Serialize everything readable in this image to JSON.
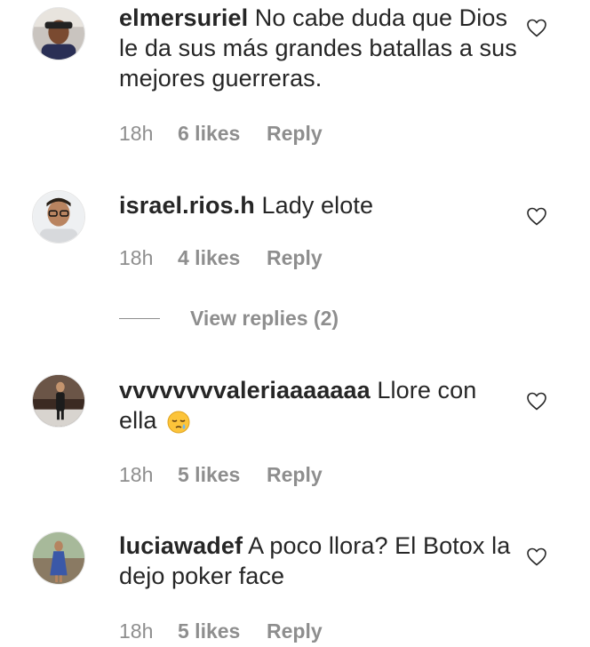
{
  "comments": [
    {
      "username": "elmersuriel",
      "text": " No cabe duda que Dios le da sus más grandes batallas a sus mejores guerreras.",
      "time": "18h",
      "likes": "6 likes",
      "reply": "Reply",
      "avatar_icon": "avatar-photo-man-cap"
    },
    {
      "username": "israel.rios.h",
      "text": " Lady elote",
      "time": "18h",
      "likes": "4 likes",
      "reply": "Reply",
      "avatar_icon": "avatar-photo-man-glasses"
    },
    {
      "username": "vvvvvvvvaleriaaaaaaa",
      "text": " Llore con ella",
      "emoji": "😪",
      "time": "18h",
      "likes": "5 likes",
      "reply": "Reply",
      "avatar_icon": "avatar-photo-woman-standing"
    },
    {
      "username": "luciawadef",
      "text": " A poco llora? El Botox la dejo poker face",
      "time": "18h",
      "likes": "5 likes",
      "reply": "Reply",
      "avatar_icon": "avatar-photo-woman-dress"
    }
  ],
  "view_replies": "View replies (2)",
  "colors": {
    "text": "#262626",
    "meta": "#8e8e8e",
    "border": "#e6e6e6"
  }
}
